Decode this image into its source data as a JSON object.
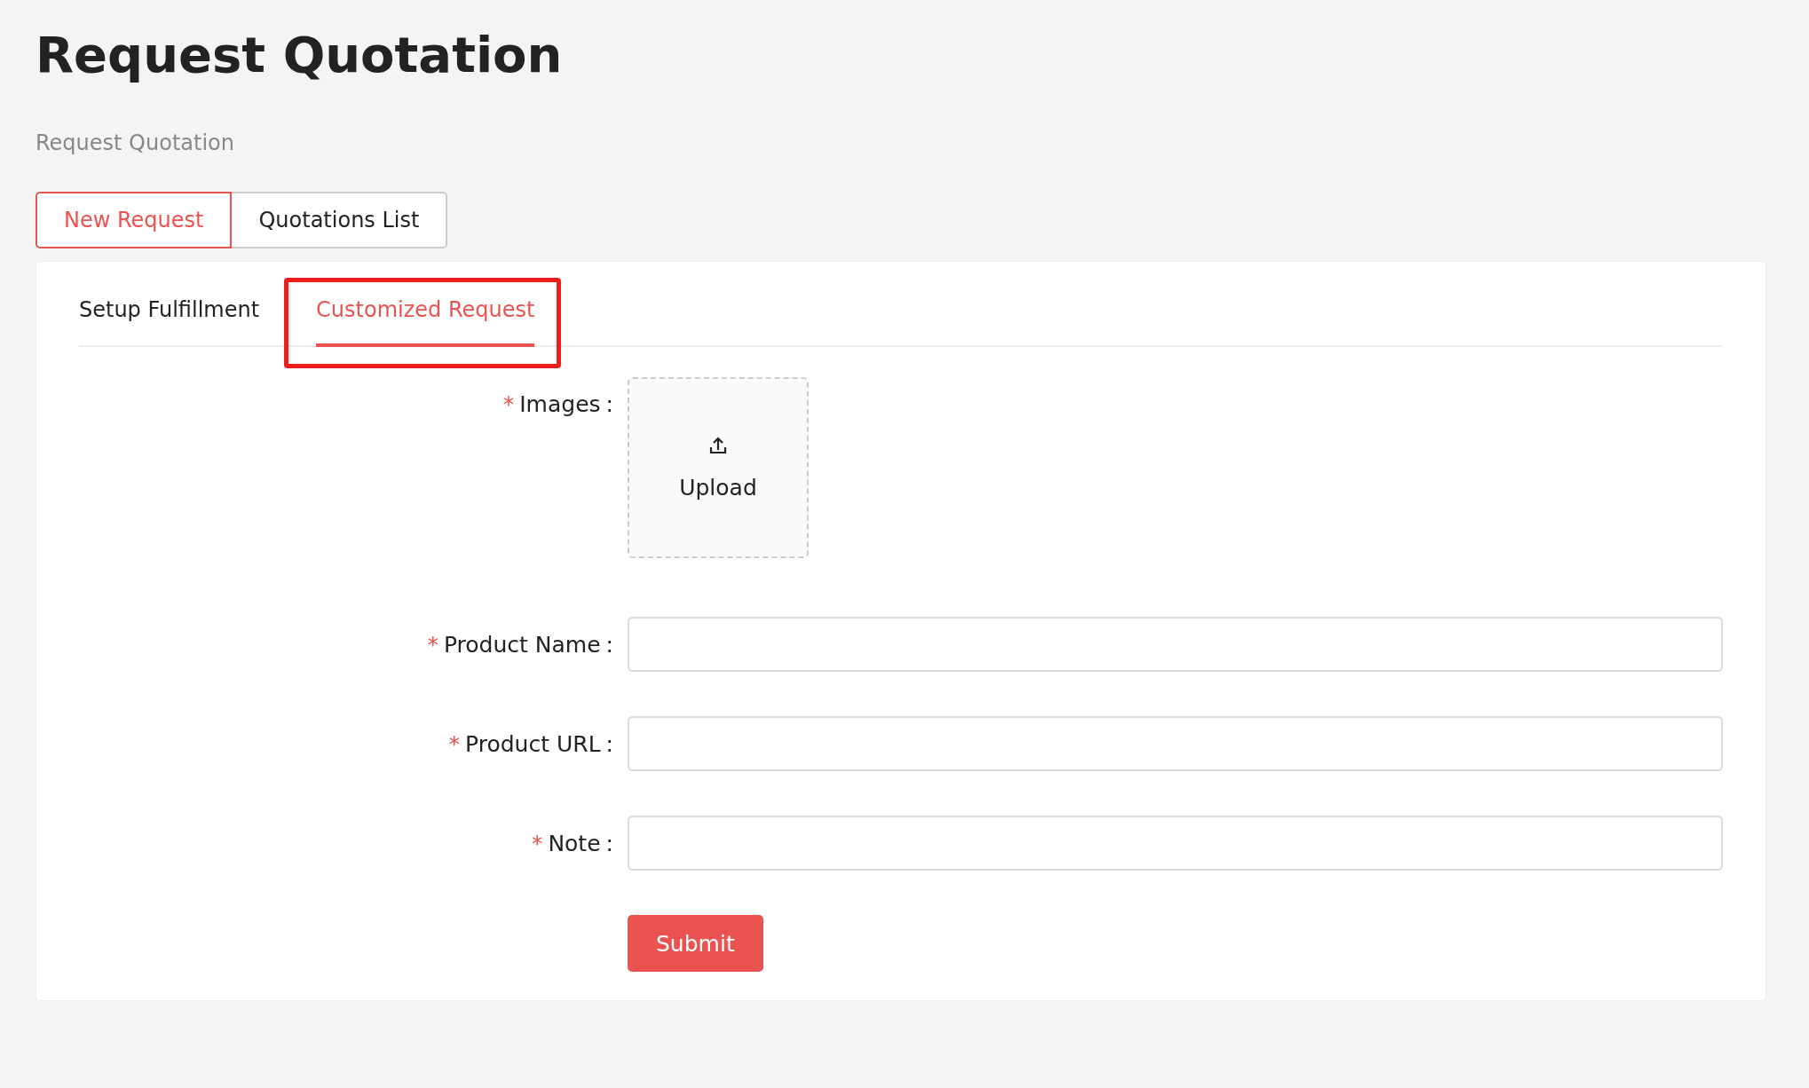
{
  "page": {
    "title": "Request Quotation",
    "breadcrumb": "Request Quotation"
  },
  "top_tabs": [
    {
      "label": "New Request",
      "selected": true
    },
    {
      "label": "Quotations List",
      "selected": false
    }
  ],
  "card": {
    "tabs": [
      {
        "label": "Setup Fulfillment",
        "selected": false,
        "highlighted": false
      },
      {
        "label": "Customized Request",
        "selected": true,
        "highlighted": true
      }
    ],
    "fields": [
      {
        "kind": "upload",
        "required_mark": "*",
        "label": "Images",
        "colon": ":",
        "button_label": "Upload"
      },
      {
        "kind": "input",
        "required_mark": "*",
        "label": "Product Name",
        "colon": ":"
      },
      {
        "kind": "input",
        "required_mark": "*",
        "label": "Product URL",
        "colon": ":"
      },
      {
        "kind": "input",
        "required_mark": "*",
        "label": "Note",
        "colon": ":"
      }
    ],
    "submit": "Submit"
  }
}
